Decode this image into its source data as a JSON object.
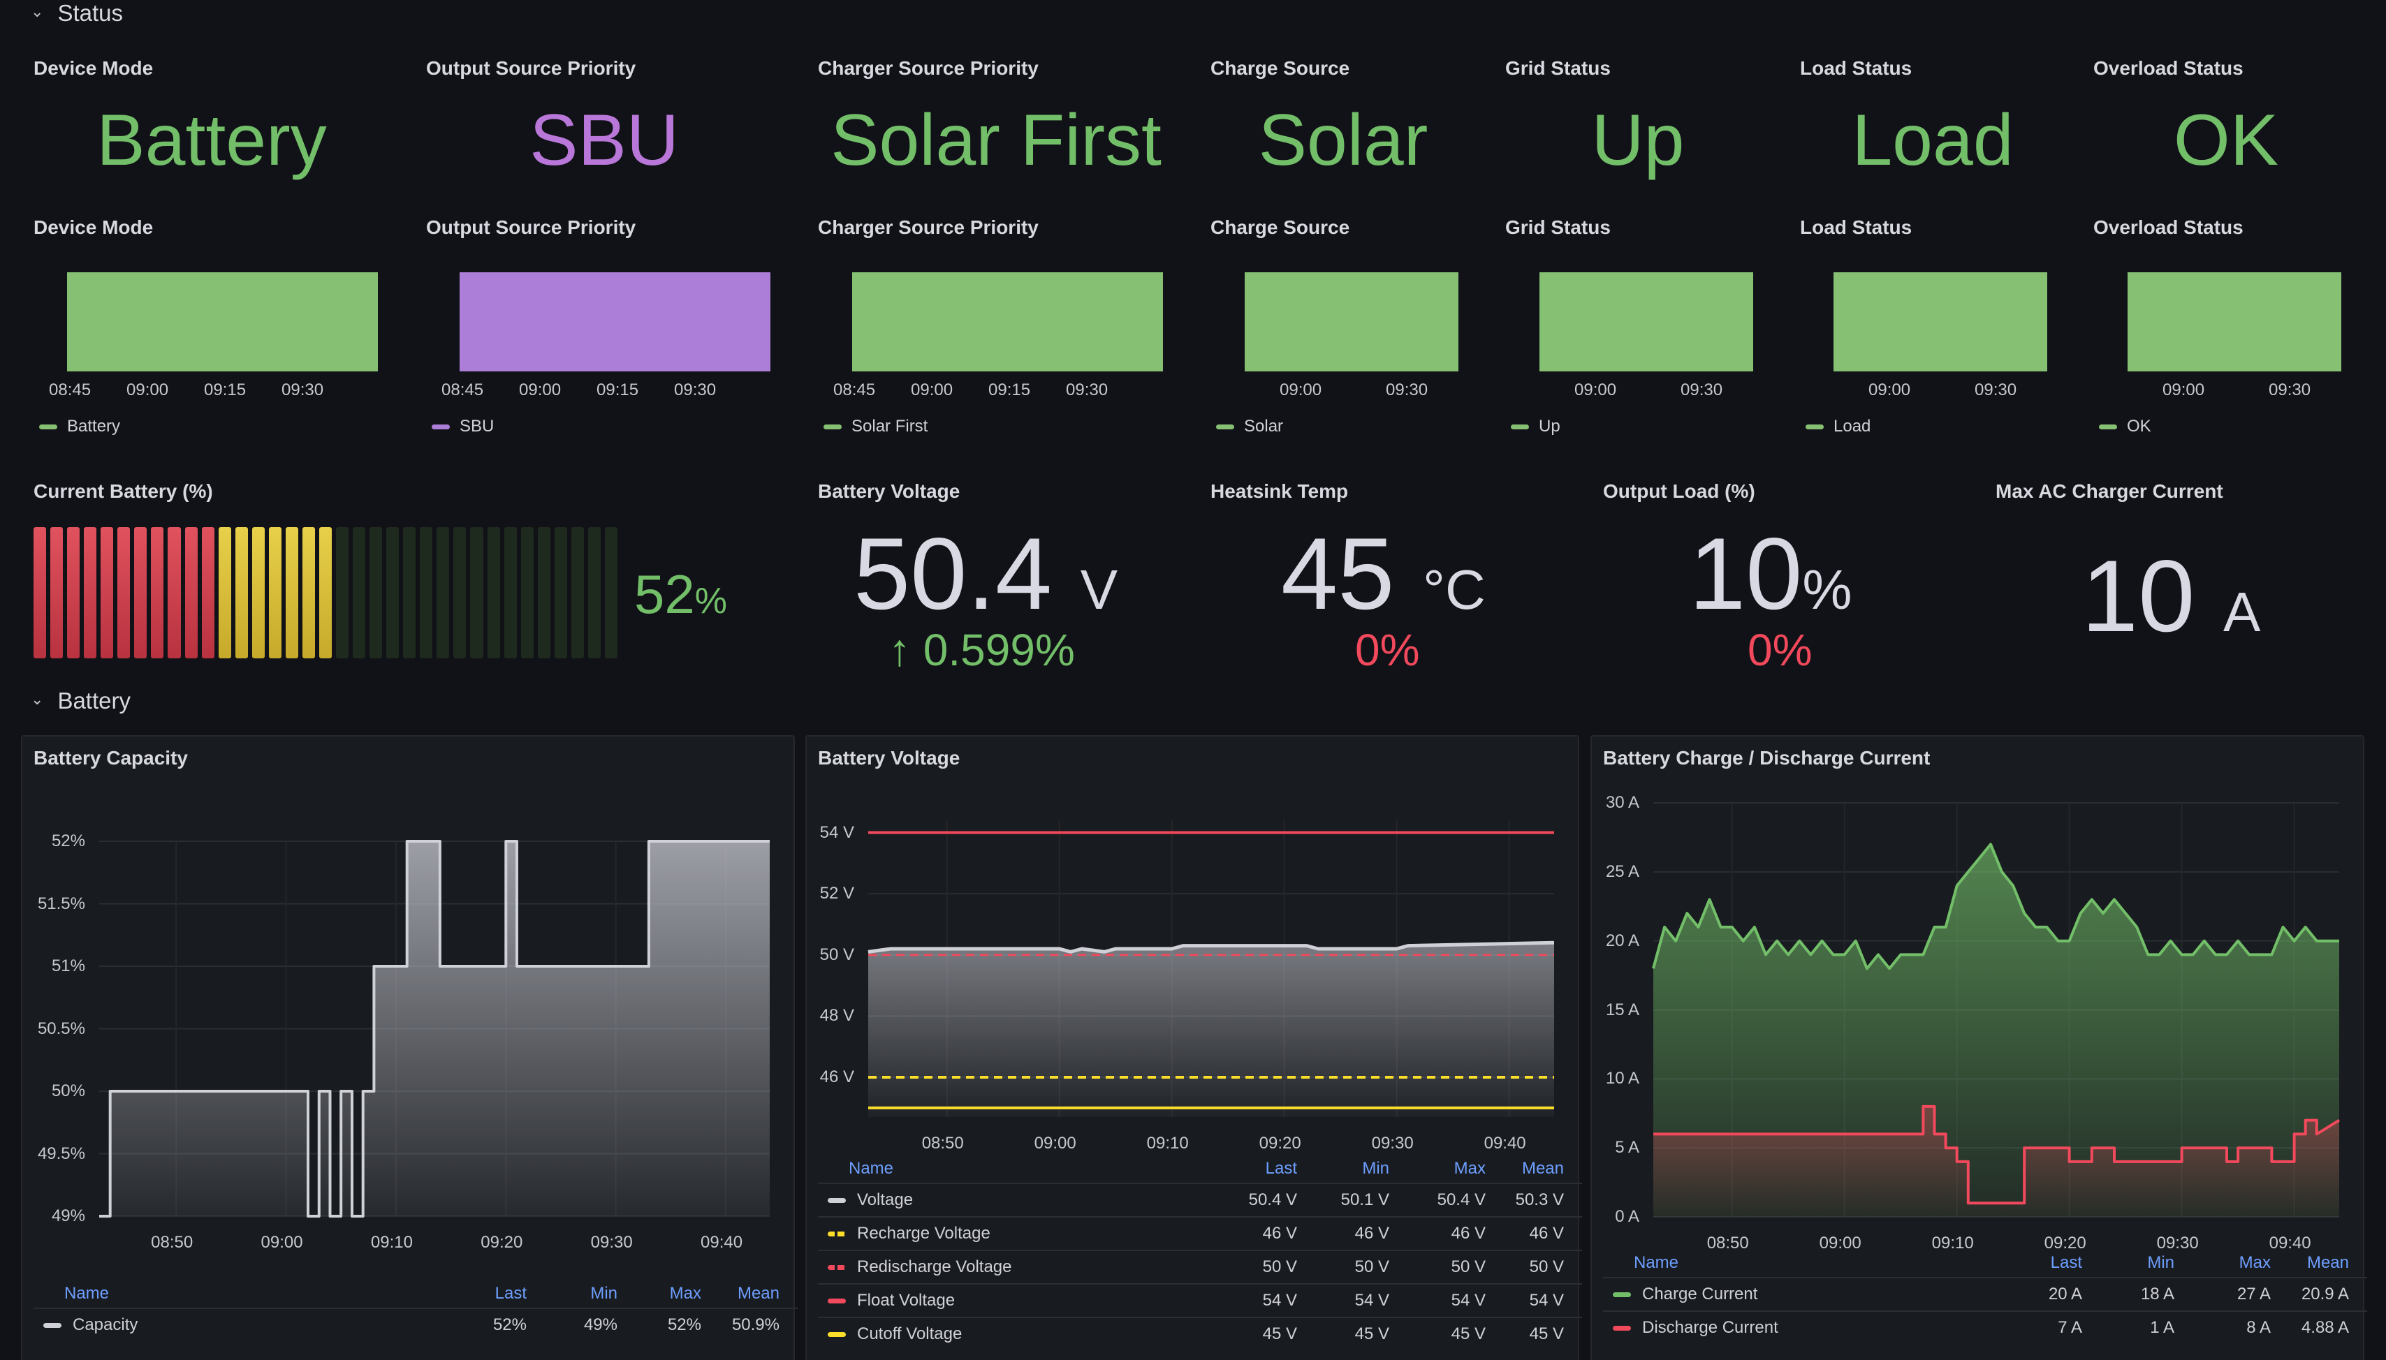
{
  "rows": {
    "status": "Status",
    "battery": "Battery"
  },
  "stats": [
    {
      "title": "Device Mode",
      "value": "Battery",
      "color": "#73bf69"
    },
    {
      "title": "Output Source Priority",
      "value": "SBU",
      "color": "#b877d9"
    },
    {
      "title": "Charger Source Priority",
      "value": "Solar First",
      "color": "#73bf69"
    },
    {
      "title": "Charge Source",
      "value": "Solar",
      "color": "#73bf69"
    },
    {
      "title": "Grid Status",
      "value": "Up",
      "color": "#73bf69"
    },
    {
      "title": "Load Status",
      "value": "Load",
      "color": "#73bf69"
    },
    {
      "title": "Overload Status",
      "value": "OK",
      "color": "#73bf69"
    }
  ],
  "timelines": [
    {
      "title": "Device Mode",
      "legend": "Battery",
      "color": "#86c173",
      "ticks": [
        "08:45",
        "09:00",
        "09:15",
        "09:30"
      ]
    },
    {
      "title": "Output Source Priority",
      "legend": "SBU",
      "color": "#ad7ed8",
      "ticks": [
        "08:45",
        "09:00",
        "09:15",
        "09:30"
      ]
    },
    {
      "title": "Charger Source Priority",
      "legend": "Solar First",
      "color": "#86c173",
      "ticks": [
        "08:45",
        "09:00",
        "09:15",
        "09:30"
      ]
    },
    {
      "title": "Charge Source",
      "legend": "Solar",
      "color": "#86c173",
      "ticks": [
        "09:00",
        "09:30"
      ]
    },
    {
      "title": "Grid Status",
      "legend": "Up",
      "color": "#86c173",
      "ticks": [
        "09:00",
        "09:30"
      ]
    },
    {
      "title": "Load Status",
      "legend": "Load",
      "color": "#86c173",
      "ticks": [
        "09:00",
        "09:30"
      ]
    },
    {
      "title": "Overload Status",
      "legend": "OK",
      "color": "#86c173",
      "ticks": [
        "09:00",
        "09:30"
      ]
    }
  ],
  "battery_gauge": {
    "title": "Current Battery (%)",
    "value": "52",
    "unit": "%",
    "percent": 52,
    "segments": 35
  },
  "battery_voltage_stat": {
    "title": "Battery Voltage",
    "value": "50.4",
    "unit": "V",
    "delta": "0.599%",
    "delta_arrow": "↑",
    "delta_color": "#73bf69"
  },
  "heatsink_stat": {
    "title": "Heatsink Temp",
    "value": "45",
    "unit": "°C",
    "delta": "0%",
    "delta_color": "#f2495c"
  },
  "output_load_stat": {
    "title": "Output Load (%)",
    "value": "10",
    "unit": "%",
    "delta": "0%",
    "delta_color": "#f2495c"
  },
  "max_ac_stat": {
    "title": "Max AC Charger Current",
    "value": "10",
    "unit": "A"
  },
  "capacity_panel": {
    "title": "Battery Capacity",
    "legend_headers": [
      "Name",
      "Last",
      "Min",
      "Max",
      "Mean"
    ],
    "legend_rows": [
      {
        "name": "Capacity",
        "color": "#d0d1d8",
        "dashed": false,
        "last": "52%",
        "min": "49%",
        "max": "52%",
        "mean": "50.9%"
      }
    ]
  },
  "voltage_panel": {
    "title": "Battery Voltage",
    "legend_headers": [
      "Name",
      "Last",
      "Min",
      "Max",
      "Mean"
    ],
    "legend_rows": [
      {
        "name": "Voltage",
        "color": "#d0d1d8",
        "dashed": false,
        "last": "50.4 V",
        "min": "50.1 V",
        "max": "50.4 V",
        "mean": "50.3 V"
      },
      {
        "name": "Recharge Voltage",
        "color": "#fade2a",
        "dashed": true,
        "last": "46 V",
        "min": "46 V",
        "max": "46 V",
        "mean": "46 V"
      },
      {
        "name": "Redischarge Voltage",
        "color": "#f2495c",
        "dashed": true,
        "last": "50 V",
        "min": "50 V",
        "max": "50 V",
        "mean": "50 V"
      },
      {
        "name": "Float Voltage",
        "color": "#f2495c",
        "dashed": false,
        "last": "54 V",
        "min": "54 V",
        "max": "54 V",
        "mean": "54 V"
      },
      {
        "name": "Cutoff Voltage",
        "color": "#fade2a",
        "dashed": false,
        "last": "45 V",
        "min": "45 V",
        "max": "45 V",
        "mean": "45 V"
      }
    ]
  },
  "current_panel": {
    "title": "Battery Charge / Discharge Current",
    "legend_headers": [
      "Name",
      "Last",
      "Min",
      "Max",
      "Mean"
    ],
    "legend_rows": [
      {
        "name": "Charge Current",
        "color": "#73bf69",
        "dashed": false,
        "last": "20 A",
        "min": "18 A",
        "max": "27 A",
        "mean": "20.9 A"
      },
      {
        "name": "Discharge Current",
        "color": "#f2495c",
        "dashed": false,
        "last": "7 A",
        "min": "1 A",
        "max": "8 A",
        "mean": "4.88 A"
      }
    ]
  },
  "chart_data": [
    {
      "type": "area",
      "title": "Battery Capacity",
      "xlabel": "",
      "ylabel": "",
      "x_ticks": [
        "08:50",
        "09:00",
        "09:10",
        "09:20",
        "09:30",
        "09:40"
      ],
      "y_ticks": [
        "49%",
        "49.5%",
        "50%",
        "50.5%",
        "51%",
        "51.5%",
        "52%"
      ],
      "ylim": [
        49,
        52
      ],
      "x_domain_minutes": [
        43,
        44
      ],
      "series": [
        {
          "name": "Capacity",
          "x": [
            "08:43",
            "08:44",
            "08:44",
            "09:02",
            "09:02",
            "09:03",
            "09:03",
            "09:04",
            "09:04",
            "09:05",
            "09:05",
            "09:06",
            "09:06",
            "09:07",
            "09:07",
            "09:08",
            "09:08",
            "09:09",
            "09:09",
            "09:11",
            "09:11",
            "09:14",
            "09:14",
            "09:17",
            "09:17",
            "09:20",
            "09:20",
            "09:21",
            "09:21",
            "09:26",
            "09:26",
            "09:33",
            "09:33",
            "09:44"
          ],
          "values": [
            49,
            49,
            50,
            50,
            49,
            49,
            50,
            50,
            49,
            49,
            50,
            50,
            49,
            49,
            50,
            50,
            51,
            51,
            51,
            51,
            52,
            52,
            51,
            51,
            51,
            51,
            52,
            52,
            51,
            51,
            51,
            51,
            52,
            52
          ]
        }
      ]
    },
    {
      "type": "line",
      "title": "Battery Voltage",
      "xlabel": "",
      "ylabel": "",
      "x_ticks": [
        "08:50",
        "09:00",
        "09:10",
        "09:20",
        "09:30",
        "09:40"
      ],
      "y_ticks": [
        "46 V",
        "48 V",
        "50 V",
        "52 V",
        "54 V"
      ],
      "ylim": [
        44.7,
        54.4
      ],
      "series": [
        {
          "name": "Voltage",
          "x": [
            "08:43",
            "08:45",
            "09:00",
            "09:01",
            "09:02",
            "09:04",
            "09:05",
            "09:10",
            "09:11",
            "09:14",
            "09:15",
            "09:22",
            "09:23",
            "09:30",
            "09:31",
            "09:44"
          ],
          "values": [
            50.1,
            50.2,
            50.2,
            50.1,
            50.2,
            50.1,
            50.2,
            50.2,
            50.3,
            50.3,
            50.3,
            50.3,
            50.2,
            50.2,
            50.3,
            50.4
          ]
        },
        {
          "name": "Recharge Voltage",
          "x": [
            "08:43",
            "09:44"
          ],
          "values": [
            46,
            46
          ]
        },
        {
          "name": "Redischarge Voltage",
          "x": [
            "08:43",
            "09:44"
          ],
          "values": [
            50,
            50
          ]
        },
        {
          "name": "Float Voltage",
          "x": [
            "08:43",
            "09:44"
          ],
          "values": [
            54,
            54
          ]
        },
        {
          "name": "Cutoff Voltage",
          "x": [
            "08:43",
            "09:44"
          ],
          "values": [
            45,
            45
          ]
        }
      ]
    },
    {
      "type": "area",
      "title": "Battery Charge / Discharge Current",
      "xlabel": "",
      "ylabel": "",
      "x_ticks": [
        "08:50",
        "09:00",
        "09:10",
        "09:20",
        "09:30",
        "09:40"
      ],
      "y_ticks": [
        "0 A",
        "5 A",
        "10 A",
        "15 A",
        "20 A",
        "25 A",
        "30 A"
      ],
      "ylim": [
        0,
        30
      ],
      "series": [
        {
          "name": "Charge Current",
          "x": [
            "08:43",
            "08:44",
            "08:45",
            "08:46",
            "08:47",
            "08:48",
            "08:49",
            "08:50",
            "08:51",
            "08:52",
            "08:53",
            "08:54",
            "08:55",
            "08:56",
            "08:57",
            "08:58",
            "08:59",
            "09:00",
            "09:01",
            "09:02",
            "09:03",
            "09:04",
            "09:05",
            "09:06",
            "09:07",
            "09:08",
            "09:09",
            "09:10",
            "09:11",
            "09:12",
            "09:13",
            "09:14",
            "09:15",
            "09:16",
            "09:17",
            "09:18",
            "09:19",
            "09:20",
            "09:21",
            "09:22",
            "09:23",
            "09:24",
            "09:25",
            "09:26",
            "09:27",
            "09:28",
            "09:29",
            "09:30",
            "09:31",
            "09:32",
            "09:33",
            "09:34",
            "09:35",
            "09:36",
            "09:37",
            "09:38",
            "09:39",
            "09:40",
            "09:41",
            "09:42",
            "09:43",
            "09:44"
          ],
          "values": [
            18,
            21,
            20,
            22,
            21,
            23,
            21,
            21,
            20,
            21,
            19,
            20,
            19,
            20,
            19,
            20,
            19,
            19,
            20,
            18,
            19,
            18,
            19,
            19,
            19,
            21,
            21,
            24,
            25,
            26,
            27,
            25,
            24,
            22,
            21,
            21,
            20,
            20,
            22,
            23,
            22,
            23,
            22,
            21,
            19,
            19,
            20,
            19,
            19,
            20,
            19,
            19,
            20,
            19,
            19,
            19,
            21,
            20,
            21,
            20,
            20,
            20
          ]
        },
        {
          "name": "Discharge Current",
          "x": [
            "08:43",
            "09:07",
            "09:07",
            "09:08",
            "09:08",
            "09:09",
            "09:09",
            "09:10",
            "09:10",
            "09:11",
            "09:11",
            "09:16",
            "09:16",
            "09:20",
            "09:20",
            "09:22",
            "09:22",
            "09:24",
            "09:24",
            "09:30",
            "09:30",
            "09:34",
            "09:34",
            "09:35",
            "09:35",
            "09:38",
            "09:38",
            "09:40",
            "09:40",
            "09:41",
            "09:41",
            "09:42",
            "09:42",
            "09:44"
          ],
          "values": [
            6,
            6,
            8,
            8,
            6,
            6,
            5,
            5,
            4,
            4,
            1,
            1,
            5,
            5,
            4,
            4,
            5,
            5,
            4,
            4,
            5,
            5,
            4,
            4,
            5,
            5,
            4,
            4,
            6,
            6,
            7,
            7,
            6,
            7
          ]
        }
      ]
    }
  ]
}
